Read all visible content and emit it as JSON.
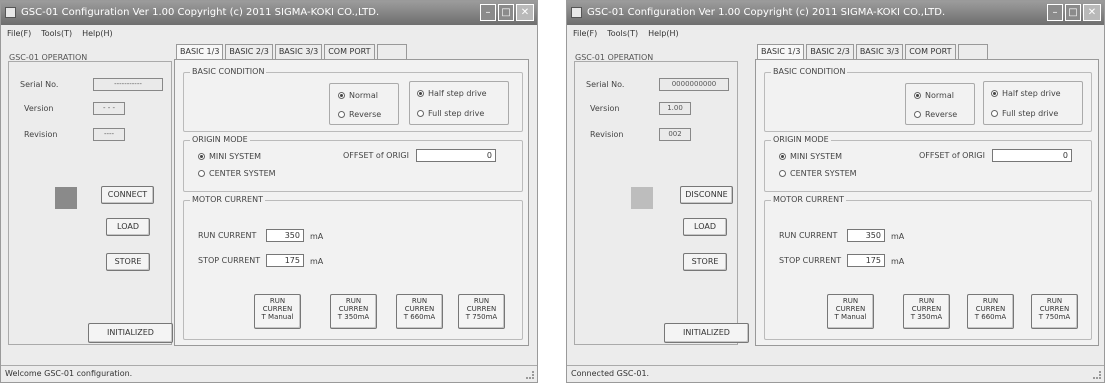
{
  "window": {
    "title": "GSC-01 Configuration  Ver 1.00  Copyright (c) 2011  SIGMA-KOKI CO.,LTD.",
    "menu": [
      "File(F)",
      "Tools(T)",
      "Help(H)"
    ]
  },
  "operation": {
    "label": "GSC-01 OPERATION",
    "serial_label": "Serial No.",
    "version_label": "Version",
    "revision_label": "Revision",
    "load_label": "LOAD",
    "store_label": "STORE",
    "initialized_label": "INITIALIZED"
  },
  "tabs": [
    "BASIC 1/3",
    "BASIC 2/3",
    "BASIC 3/3",
    "COM PORT",
    ""
  ],
  "basic": {
    "condition_title": "BASIC CONDITION",
    "normal": "Normal",
    "reverse": "Reverse",
    "half_step": "Half step drive",
    "full_step": "Full step drive",
    "origin_title": "ORIGIN MODE",
    "mini_system": "MINI SYSTEM",
    "center_system": "CENTER SYSTEM",
    "offset_label": "OFFSET of ORIGI",
    "offset_value": "0",
    "motor_title": "MOTOR CURRENT",
    "run_current_label": "RUN CURRENT",
    "run_current_value": "350",
    "stop_current_label": "STOP CURRENT",
    "stop_current_value": "175",
    "unit": "mA",
    "run_buttons": [
      [
        "RUN",
        "CURREN",
        "T Manual"
      ],
      [
        "RUN",
        "CURREN",
        "T 350mA"
      ],
      [
        "RUN",
        "CURREN",
        "T 660mA"
      ],
      [
        "RUN",
        "CURREN",
        "T 750mA"
      ]
    ]
  },
  "screen_disconnected": {
    "serial_value": "-----------",
    "version_value": "- - -",
    "revision_value": "----",
    "connect_label": "CONNECT",
    "indicator_color": "#8a8a8a",
    "status": "Welcome GSC-01 configuration."
  },
  "screen_connected": {
    "serial_value": "0000000000",
    "version_value": "1.00",
    "revision_value": "002",
    "connect_label": "DISCONNE",
    "indicator_color": "#bdbdbd",
    "status": "Connected GSC-01."
  }
}
